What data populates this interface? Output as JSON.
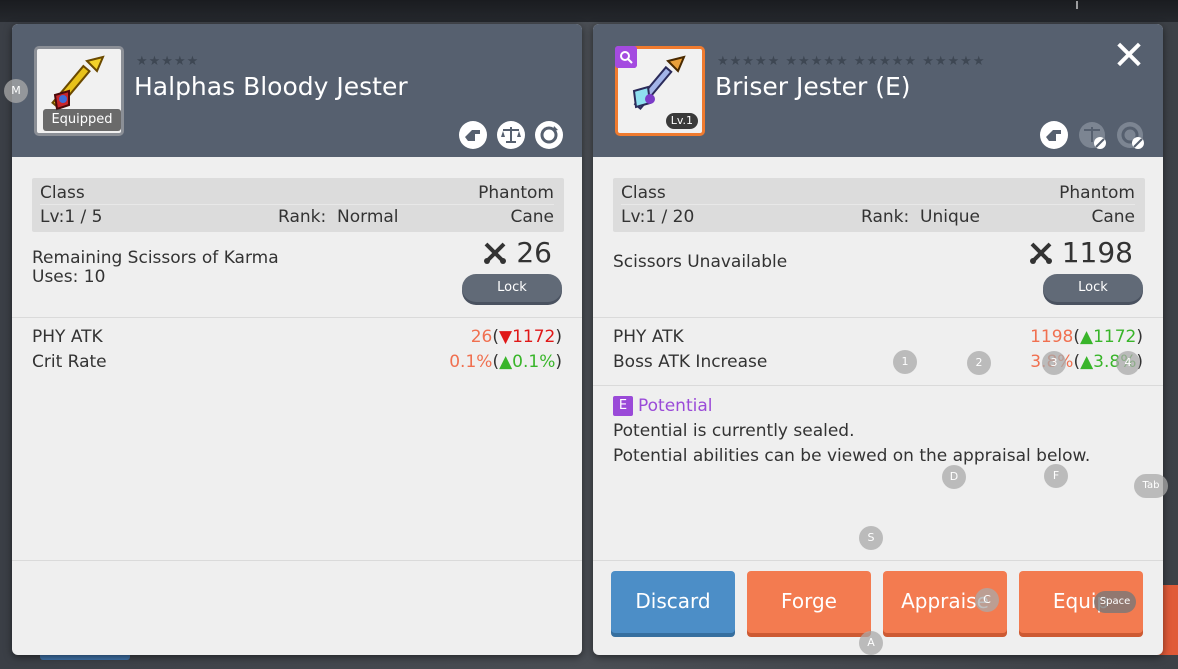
{
  "left_panel": {
    "stars": "★★★★★",
    "title": "Halphas Bloody Jester",
    "equipped_label": "Equipped",
    "class_label": "Class",
    "class_value": "Phantom",
    "level": "Lv:1 / 5",
    "rank_label": "Rank:",
    "rank_value": "Normal",
    "weapon_type": "Cane",
    "scissors_line1": "Remaining Scissors of Karma",
    "scissors_line2": "Uses: 10",
    "scissors_count": "26",
    "lock_label": "Lock",
    "stats": [
      {
        "label": "PHY ATK",
        "base": "26",
        "open": "(",
        "arrow": "▼",
        "delta": "1172",
        "close": ")"
      },
      {
        "label": "Crit Rate",
        "base": "0.1%",
        "open": "(",
        "arrow": "▲",
        "delta": "0.1%",
        "close": ")"
      }
    ],
    "icons": [
      "hand-icon",
      "scale-icon",
      "refresh-icon"
    ]
  },
  "right_panel": {
    "stars": "★★★★★ ★★★★★ ★★★★★ ★★★★★",
    "title": "Briser Jester (E)",
    "lv_badge": "Lv.1",
    "class_label": "Class",
    "class_value": "Phantom",
    "level": "Lv:1 / 20",
    "rank_label": "Rank:",
    "rank_value": "Unique",
    "weapon_type": "Cane",
    "scissors_text": "Scissors Unavailable",
    "scissors_count": "1198",
    "lock_label": "Lock",
    "stats": [
      {
        "label": "PHY ATK",
        "base": "1198",
        "open": "(",
        "arrow": "▲",
        "delta": "1172",
        "close": ")"
      },
      {
        "label": "Boss ATK Increase",
        "base": "3.8%",
        "open": "(",
        "arrow": "▲",
        "delta": "3.8%",
        "close": ")"
      }
    ],
    "potential_badge": "E",
    "potential_title": "Potential",
    "potential_line1": "Potential is currently sealed.",
    "potential_line2": "Potential abilities can be viewed on the appraisal below.",
    "buttons": {
      "discard": "Discard",
      "forge": "Forge",
      "appraise": "Appraise",
      "equip": "Equip"
    },
    "icons": [
      "hand-icon",
      "scale-disabled-icon",
      "refresh-disabled-icon"
    ],
    "close_symbol": "✕"
  },
  "key_hints": {
    "m": "M",
    "k1": "1",
    "k2": "2",
    "k3": "3",
    "k4": "4",
    "d": "D",
    "f": "F",
    "tab": "Tab",
    "s": "S",
    "c": "C",
    "space": "Space",
    "a": "A",
    "i": "I"
  },
  "colors": {
    "header_bg": "#56606f",
    "panel_bg": "#efefef",
    "accent_orange": "#f37b50",
    "accent_blue": "#4c8ec7",
    "potential_purple": "#9a4ad8",
    "increase_green": "#39b52a",
    "decrease_red": "#e01818"
  }
}
